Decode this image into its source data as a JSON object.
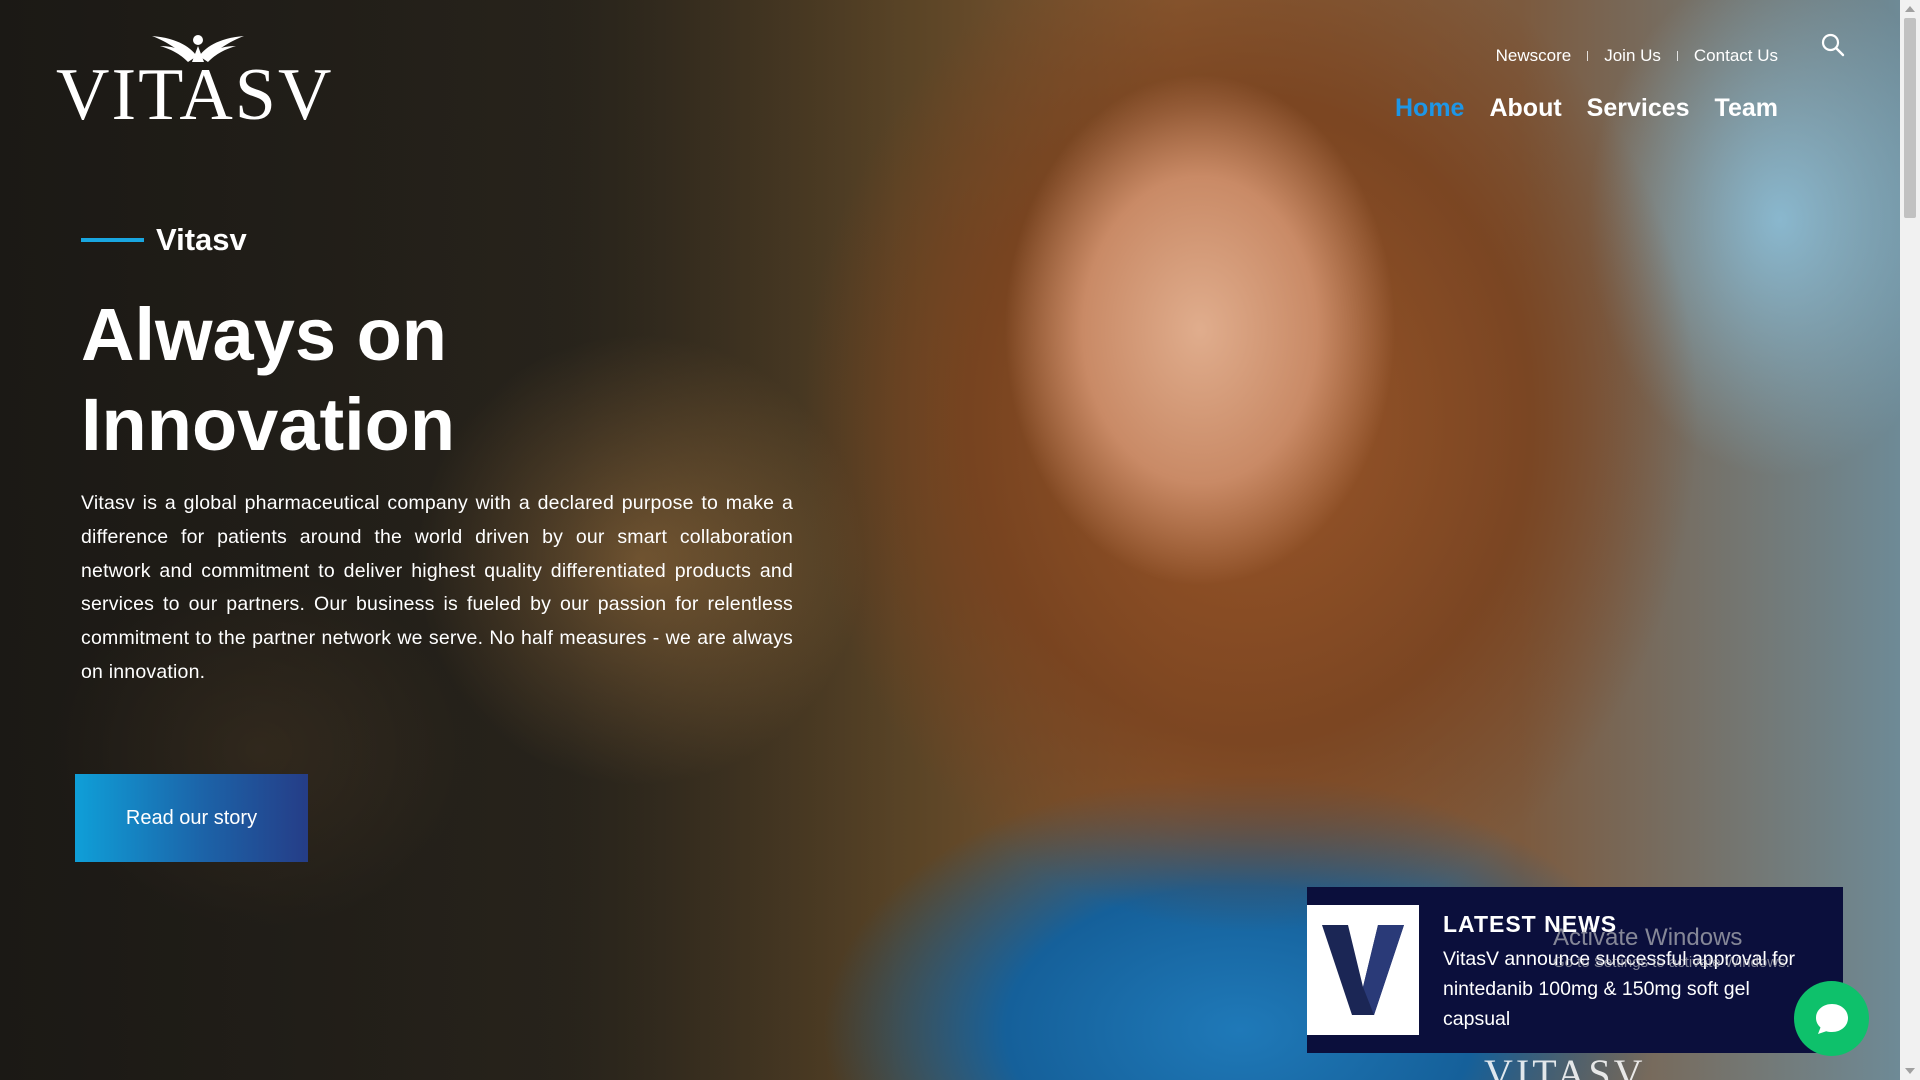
{
  "brand": {
    "logo_text": "VITASV"
  },
  "utility_nav": {
    "newscore": "Newscore",
    "join_us": "Join Us",
    "contact_us": "Contact Us"
  },
  "main_nav": {
    "home": "Home",
    "about": "About",
    "services": "Services",
    "team": "Team"
  },
  "hero": {
    "eyebrow": "Vitasv",
    "headline_line1": "Always on",
    "headline_line2": "Innovation",
    "intro": "Vitasv is a global pharmaceutical company with a declared purpose to make a difference for patients around the world driven by our smart collaboration network and commitment to deliver highest quality differentiated products and services to our partners. Our business is fueled by our passion for relentless commitment to the partner network we serve. No half measures - we are always on innovation.",
    "cta_label": "Read our story"
  },
  "news": {
    "logo_letter": "V",
    "title": "LATEST NEWS",
    "text": "VitasV announce successful approval for nintedanib 100mg & 150mg soft gel capsual"
  },
  "watermark": {
    "line1": "Activate Windows",
    "line2": "Go to Settings to activate Windows."
  },
  "shirt_logo": "VITASV",
  "colors": {
    "accent_blue": "#1e96e6",
    "cta_start": "#0f9fd8",
    "cta_end": "#253d87",
    "news_bg": "#0b0f3c",
    "chat_green": "#0ec16b"
  },
  "icons": {
    "search": "search-icon",
    "chat": "chat-bubble-icon",
    "wings": "wings-icon"
  }
}
